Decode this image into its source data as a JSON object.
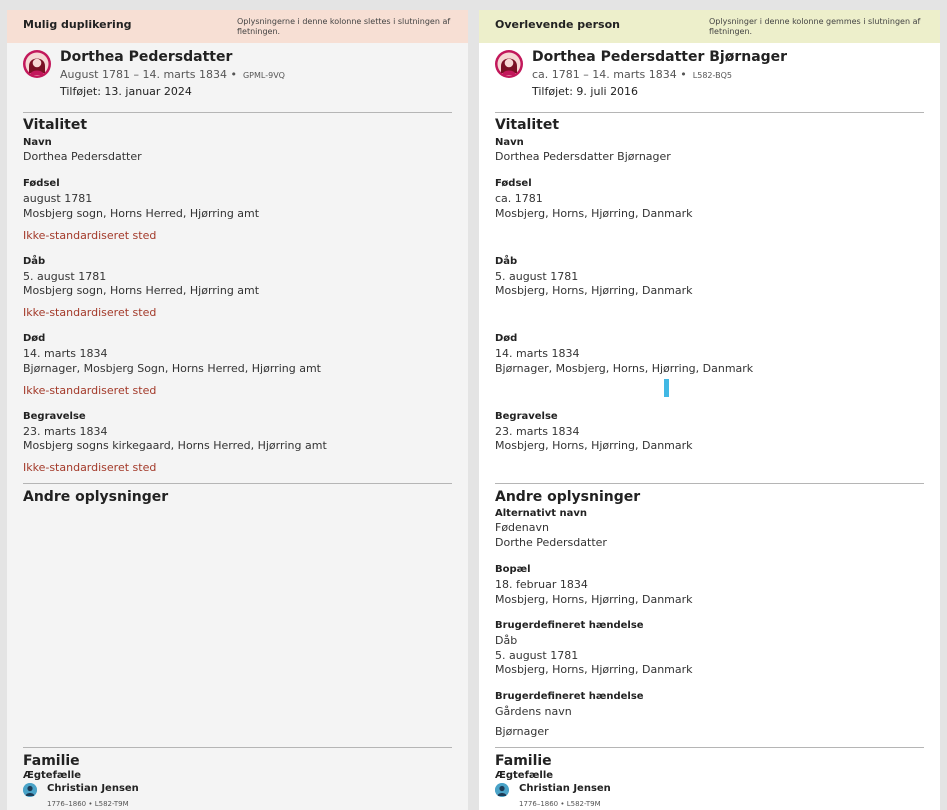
{
  "left": {
    "header": {
      "title": "Mulig duplikering",
      "note": "Oplysningerne i denne kolonne slettes i slutningen af fletningen."
    },
    "person": {
      "name": "Dorthea Pedersdatter",
      "dates": "August 1781 – 14. marts 1834 •",
      "id": "GPML-9VQ",
      "added": "Tilføjet: 13. januar 2024"
    },
    "vital": {
      "title": "Vitalitet",
      "name_label": "Navn",
      "name_value": "Dorthea Pedersdatter",
      "birth_label": "Fødsel",
      "birth_date": "august 1781",
      "birth_place": "Mosbjerg sogn, Horns Herred, Hjørring amt",
      "birth_warn": "Ikke-standardiseret sted",
      "bapt_label": "Dåb",
      "bapt_date": "5. august 1781",
      "bapt_place": "Mosbjerg sogn, Horns Herred, Hjørring amt",
      "bapt_warn": "Ikke-standardiseret sted",
      "death_label": "Død",
      "death_date": "14. marts 1834",
      "death_place": "Bjørnager, Mosbjerg Sogn, Horns Herred, Hjørring amt",
      "death_warn": "Ikke-standardiseret sted",
      "burial_label": "Begravelse",
      "burial_date": "23. marts 1834",
      "burial_place": "Mosbjerg sogns kirkegaard, Horns Herred, Hjørring amt",
      "burial_warn": "Ikke-standardiseret sted"
    },
    "other": {
      "title": "Andre oplysninger"
    },
    "family": {
      "title": "Familie",
      "spouse_label": "Ægtefælle",
      "spouse_name": "Christian Jensen",
      "spouse_dates": "1776–1860",
      "spouse_id": "L582-T9M"
    }
  },
  "right": {
    "header": {
      "title": "Overlevende person",
      "note": "Oplysninger i denne kolonne gemmes i slutningen af fletningen."
    },
    "person": {
      "name": "Dorthea Pedersdatter Bjørnager",
      "dates": "ca. 1781 – 14. marts 1834 •",
      "id": "L582-BQ5",
      "added": "Tilføjet: 9. juli 2016"
    },
    "vital": {
      "title": "Vitalitet",
      "name_label": "Navn",
      "name_value": "Dorthea Pedersdatter Bjørnager",
      "birth_label": "Fødsel",
      "birth_date": "ca. 1781",
      "birth_place": "Mosbjerg, Horns, Hjørring, Danmark",
      "bapt_label": "Dåb",
      "bapt_date": "5. august 1781",
      "bapt_place": "Mosbjerg, Horns, Hjørring, Danmark",
      "death_label": "Død",
      "death_date": "14. marts 1834",
      "death_place": "Bjørnager, Mosbjerg, Horns, Hjørring, Danmark",
      "burial_label": "Begravelse",
      "burial_date": "23. marts 1834",
      "burial_place": "Mosbjerg, Horns, Hjørring, Danmark"
    },
    "other": {
      "title": "Andre oplysninger",
      "alt_label": "Alternativt navn",
      "alt_type": "Fødenavn",
      "alt_value": "Dorthe Pedersdatter",
      "res_label": "Bopæl",
      "res_date": "18. februar 1834",
      "res_place": "Mosbjerg, Horns, Hjørring, Danmark",
      "custom1_label": "Brugerdefineret hændelse",
      "custom1_type": "Dåb",
      "custom1_date": "5. august 1781",
      "custom1_place": "Mosbjerg, Horns, Hjørring, Danmark",
      "custom2_label": "Brugerdefineret hændelse",
      "custom2_type": "Gårdens navn",
      "custom2_value": "Bjørnager"
    },
    "family": {
      "title": "Familie",
      "spouse_label": "Ægtefælle",
      "spouse_name": "Christian Jensen",
      "spouse_dates": "1776–1860",
      "spouse_id": "L582-T9M"
    }
  },
  "colors": {
    "left_header": "#f7dfd4",
    "right_header": "#edefcb",
    "warning": "#a33a2a",
    "female_avatar": "#c2185b",
    "male_avatar": "#4aa3c8"
  },
  "icons": {
    "person_female": "female-avatar-icon",
    "person_male": "male-avatar-icon"
  }
}
